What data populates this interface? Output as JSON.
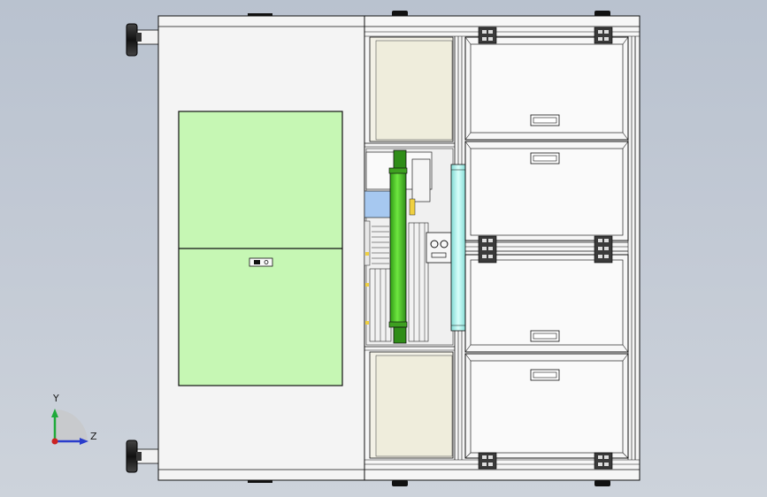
{
  "viewport": {
    "background_top": "#b9c2cf",
    "background_bottom": "#cdd3db"
  },
  "triad": {
    "y_label": "Y",
    "z_label": "Z",
    "y_color": "#1faa3a",
    "z_color": "#2a3dcc",
    "x_color": "#cc2222"
  },
  "colors": {
    "panel_green": "#c6f7b4",
    "cylinder_green": "#55d332",
    "cylinder_cyan": "#aaf4ee",
    "frame_white": "#f4f4f4",
    "outline": "#111111"
  }
}
